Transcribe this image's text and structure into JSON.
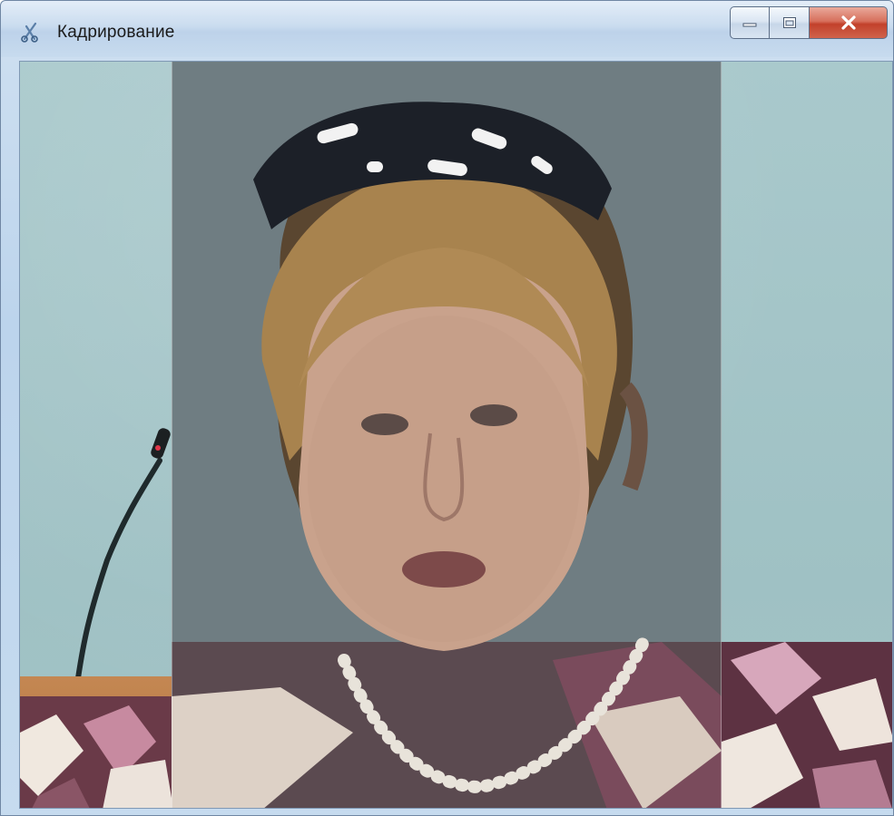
{
  "window": {
    "title": "Кадрирование",
    "icons": {
      "app": "scissors-icon",
      "minimize": "minimize-icon",
      "maximize": "maximize-icon",
      "close": "close-icon"
    }
  },
  "colors": {
    "titlebar": "#c7dbee",
    "close_button": "#c2412b",
    "wall": "#a6c6c9",
    "crop_background": "#6e7c80"
  }
}
